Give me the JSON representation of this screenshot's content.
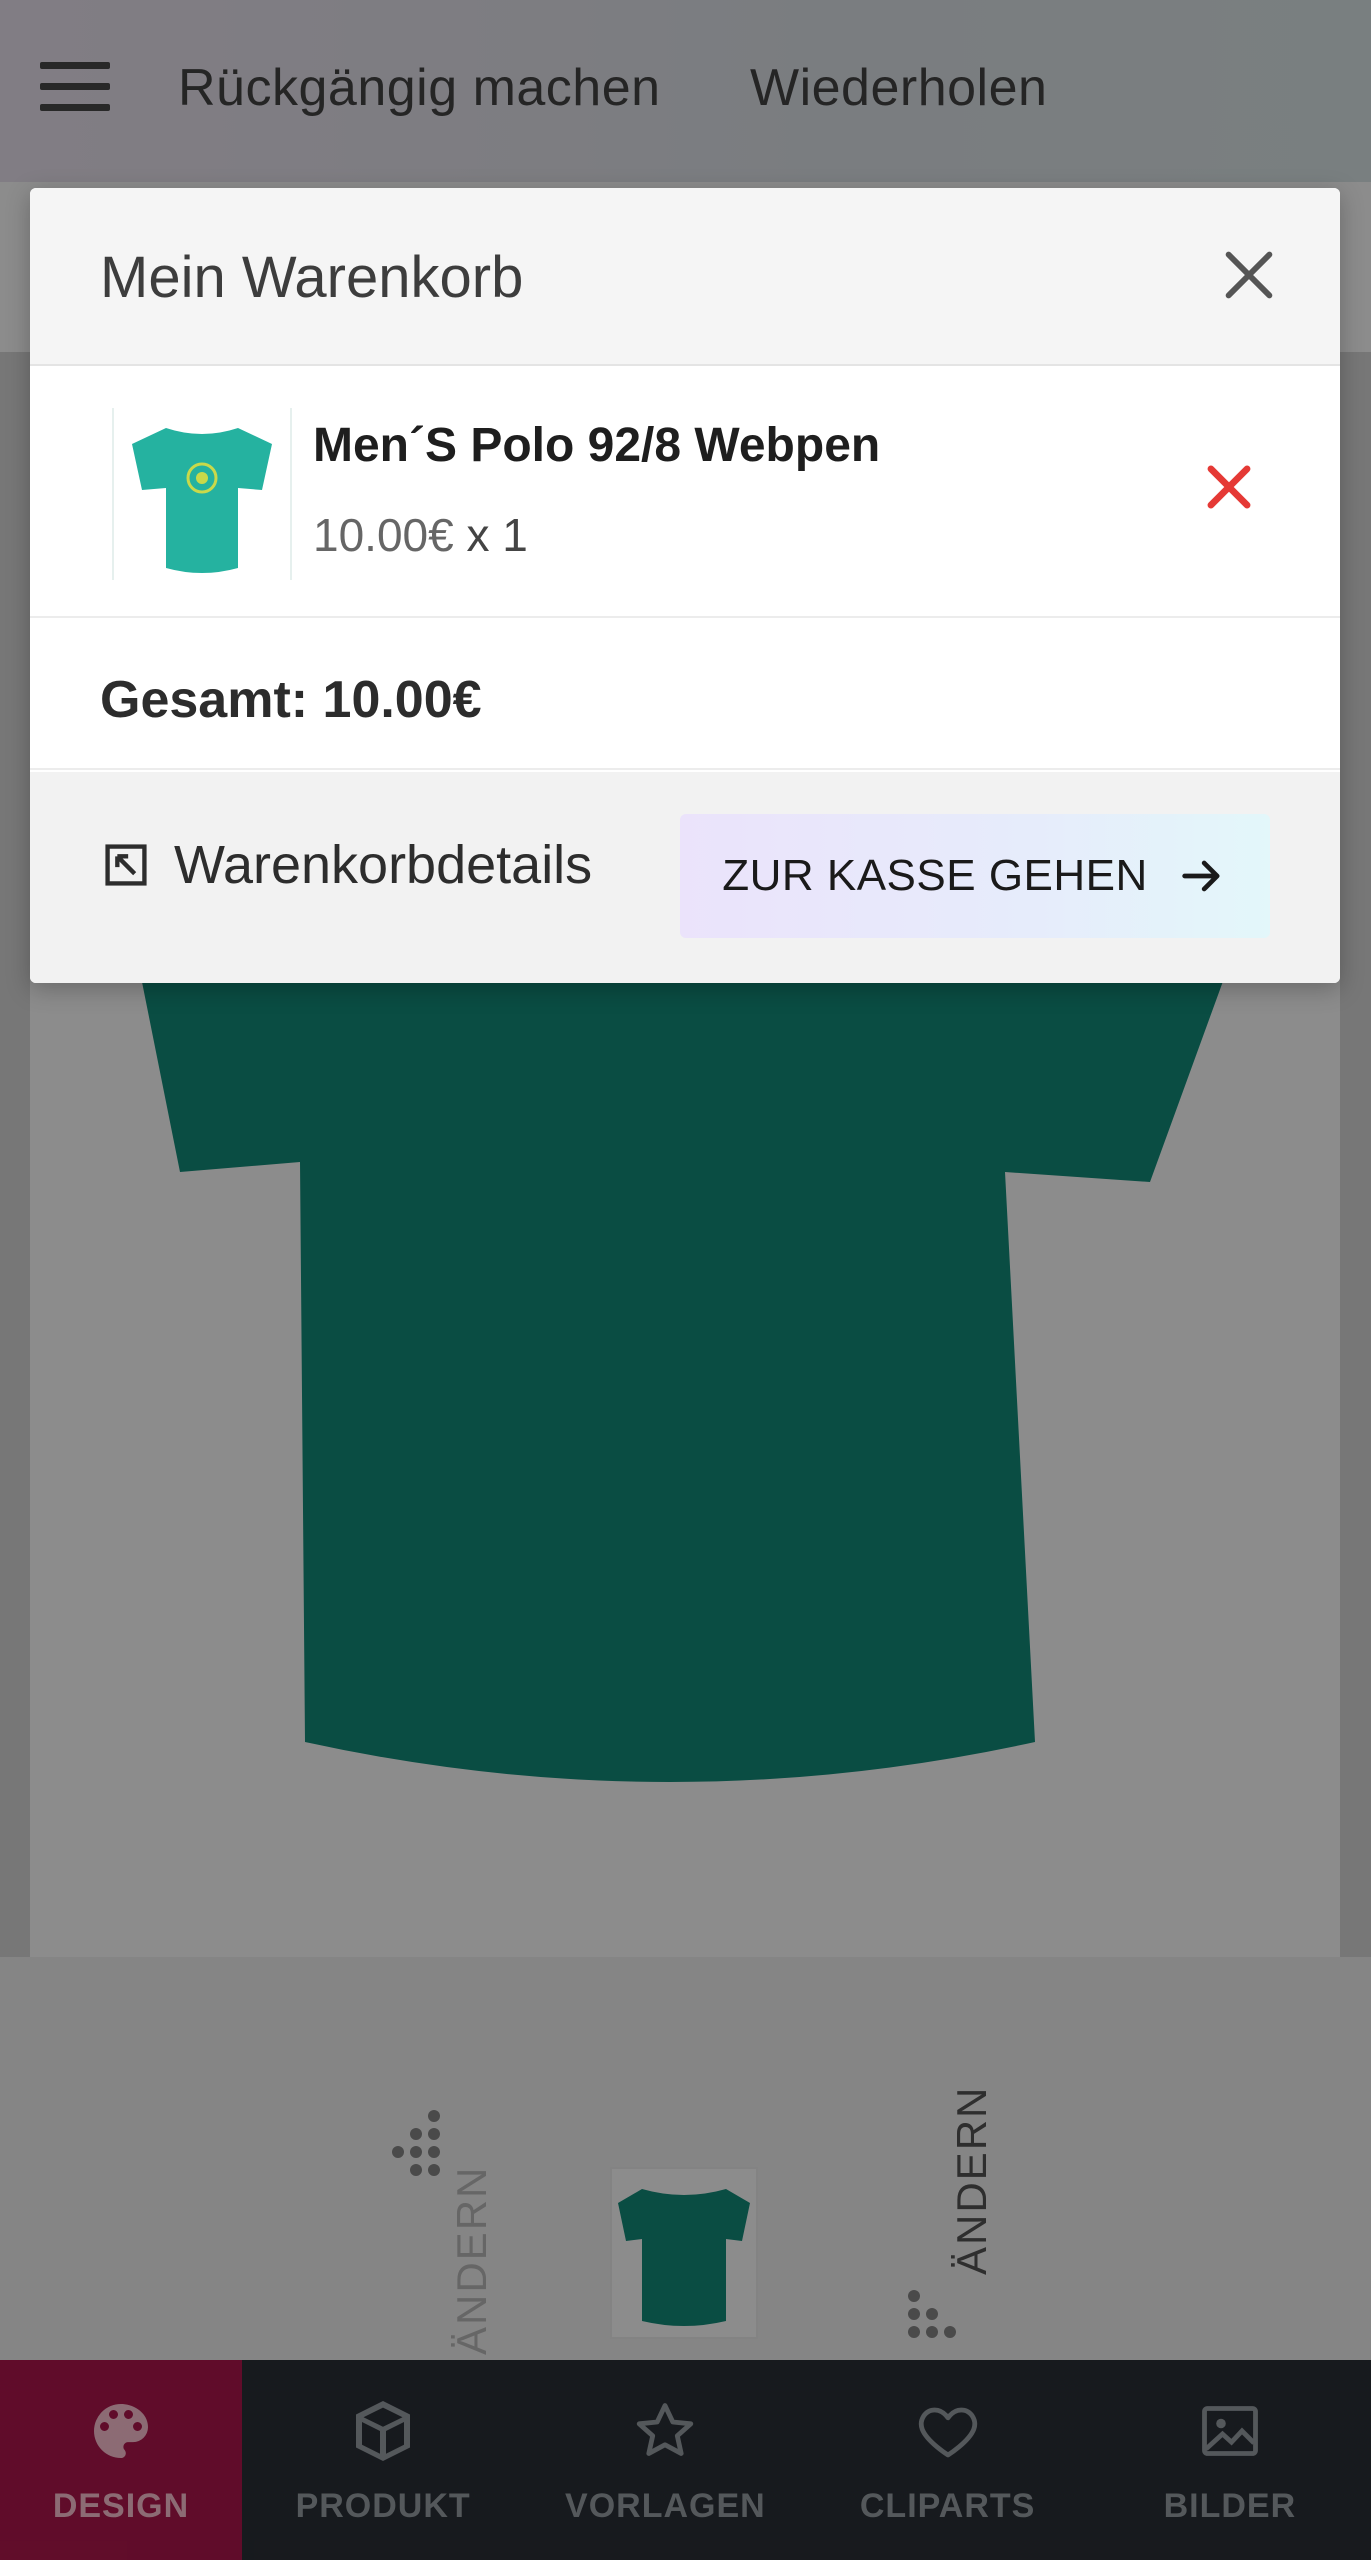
{
  "topbar": {
    "undo_label": "Rückgängig machen",
    "redo_label": "Wiederholen"
  },
  "product_view": {
    "shirt_color": "#138c7a",
    "vertical_label_left": "ÄNDERN",
    "vertical_label_right": "ÄNDERN"
  },
  "bottom_nav": {
    "items": [
      {
        "label": "DESIGN",
        "icon": "palette-icon",
        "active": true
      },
      {
        "label": "PRODUKT",
        "icon": "box-icon",
        "active": false
      },
      {
        "label": "VORLAGEN",
        "icon": "star-icon",
        "active": false
      },
      {
        "label": "CLIPARTS",
        "icon": "heart-icon",
        "active": false
      },
      {
        "label": "BILDER",
        "icon": "image-icon",
        "active": false
      }
    ],
    "active_color": "#b0174d"
  },
  "cart": {
    "title": "Mein Warenkorb",
    "items": [
      {
        "name": "Men´S Polo 92/8 Webpen",
        "price": "10.00€",
        "quantity_text": "x 1",
        "thumb_color": "#25b2a0"
      }
    ],
    "total_text": "Gesamt: 10.00€",
    "details_label": "Warenkorbdetails",
    "checkout_label": "ZUR KASSE GEHEN",
    "remove_color": "#e53935"
  }
}
